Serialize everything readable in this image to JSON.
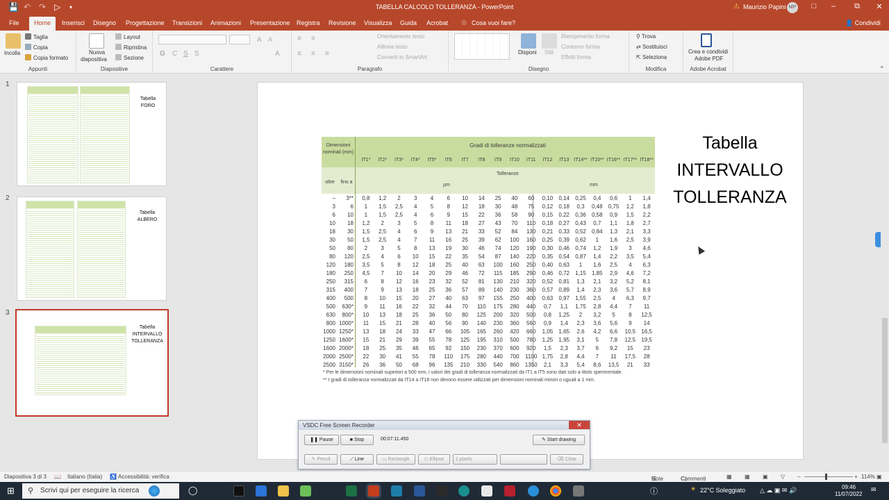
{
  "titlebar": {
    "title": "TABELLA CALCOLO TOLLERANZA - PowerPoint",
    "user": "Maurizio Papini",
    "initials": "MP"
  },
  "tabs": [
    {
      "label": "File"
    },
    {
      "label": "Home"
    },
    {
      "label": "Inserisci"
    },
    {
      "label": "Disegno"
    },
    {
      "label": "Progettazione"
    },
    {
      "label": "Transizioni"
    },
    {
      "label": "Animazioni"
    },
    {
      "label": "Presentazione"
    },
    {
      "label": "Registra"
    },
    {
      "label": "Revisione"
    },
    {
      "label": "Visualizza"
    },
    {
      "label": "Guida"
    },
    {
      "label": "Acrobat"
    },
    {
      "label": "Cosa vuoi fare?"
    }
  ],
  "share_label": "Condividi",
  "ribbon": {
    "appunti": {
      "label": "Appunti",
      "incolla": "Incolla",
      "taglia": "Taglia",
      "copia": "Copia",
      "copia_formato": "Copia formato"
    },
    "diapositive": {
      "label": "Diapositive",
      "nuova": "Nuova",
      "diapositiva": "diapositiva",
      "layout": "Layout",
      "ripristina": "Ripristina",
      "sezione": "Sezione"
    },
    "carattere": {
      "label": "Carattere"
    },
    "paragrafo": {
      "label": "Paragrafo",
      "orientamento": "Orientamento testo",
      "allinea": "Allinea testo",
      "smartart": "Converti in SmartArt"
    },
    "disegno": {
      "label": "Disegno",
      "disponi": "Disponi",
      "stili": "Stili",
      "riempimento": "Riempimento forma",
      "contorno": "Contorno forma",
      "effetti": "Effetti forma"
    },
    "modifica": {
      "label": "Modifica",
      "trova": "Trova",
      "sostituisci": "Sostituisci",
      "seleziona": "Seleziona"
    },
    "acrobat": {
      "label": "Adobe Acrobat",
      "crea": "Crea e condividi",
      "pdf": "Adobe PDF"
    }
  },
  "thumbnails": [
    {
      "num": "1",
      "label1": "Tabella",
      "label2": "FORO",
      "label3": ""
    },
    {
      "num": "2",
      "label1": "Tabella",
      "label2": "ALBERO",
      "label3": ""
    },
    {
      "num": "3",
      "label1": "Tabella",
      "label2": "INTERVALLO",
      "label3": "TOLLERANZA"
    }
  ],
  "slide": {
    "title_line1": "Tabella",
    "title_line2": "INTERVALLO",
    "title_line3": "TOLLERANZA",
    "table": {
      "header_dim": "Dimensioni nominali (mm)",
      "header_grades": "Gradi di tolleranze normalizzati",
      "header_tolleranze": "Tolleranze",
      "header_oltre": "oltre",
      "header_fino": "fino a",
      "unit_um": "µm",
      "unit_mm": "mm",
      "grades": [
        "IT1*",
        "IT2*",
        "IT3*",
        "IT4*",
        "IT5*",
        "IT6",
        "IT7",
        "IT8",
        "IT9",
        "IT10",
        "IT11",
        "IT12",
        "IT13",
        "IT14**",
        "IT15**",
        "IT16**",
        "IT17**",
        "IT18**"
      ],
      "rows": [
        [
          "–",
          "3**",
          "0,8",
          "1,2",
          "2",
          "3",
          "4",
          "6",
          "10",
          "14",
          "25",
          "40",
          "60",
          "0,10",
          "0,14",
          "0,25",
          "0,4",
          "0,6",
          "1",
          "1,4"
        ],
        [
          "3",
          "6",
          "1",
          "1,5",
          "2,5",
          "4",
          "5",
          "8",
          "12",
          "18",
          "30",
          "48",
          "75",
          "0,12",
          "0,18",
          "0,3",
          "0,48",
          "0,75",
          "1,2",
          "1,8"
        ],
        [
          "6",
          "10",
          "1",
          "1,5",
          "2,5",
          "4",
          "6",
          "9",
          "15",
          "22",
          "36",
          "58",
          "90",
          "0,15",
          "0,22",
          "0,36",
          "0,58",
          "0,9",
          "1,5",
          "2,2"
        ],
        [
          "10",
          "18",
          "1,2",
          "2",
          "3",
          "5",
          "8",
          "11",
          "18",
          "27",
          "43",
          "70",
          "110",
          "0,18",
          "0,27",
          "0,43",
          "0,7",
          "1,1",
          "1,8",
          "2,7"
        ],
        [
          "18",
          "30",
          "1,5",
          "2,5",
          "4",
          "6",
          "9",
          "13",
          "21",
          "33",
          "52",
          "84",
          "130",
          "0,21",
          "0,33",
          "0,52",
          "0,84",
          "1,3",
          "2,1",
          "3,3"
        ],
        [
          "30",
          "50",
          "1,5",
          "2,5",
          "4",
          "7",
          "11",
          "16",
          "25",
          "39",
          "62",
          "100",
          "160",
          "0,25",
          "0,39",
          "0,62",
          "1",
          "1,6",
          "2,5",
          "3,9"
        ],
        [
          "50",
          "80",
          "2",
          "3",
          "5",
          "8",
          "13",
          "19",
          "30",
          "46",
          "74",
          "120",
          "190",
          "0,30",
          "0,46",
          "0,74",
          "1,2",
          "1,9",
          "3",
          "4,6"
        ],
        [
          "80",
          "120",
          "2,5",
          "4",
          "6",
          "10",
          "15",
          "22",
          "35",
          "54",
          "87",
          "140",
          "220",
          "0,35",
          "0,54",
          "0,87",
          "1,4",
          "2,2",
          "3,5",
          "5,4"
        ],
        [
          "120",
          "180",
          "3,5",
          "5",
          "8",
          "12",
          "18",
          "25",
          "40",
          "63",
          "100",
          "160",
          "250",
          "0,40",
          "0,63",
          "1",
          "1,6",
          "2,5",
          "4",
          "6,3"
        ],
        [
          "180",
          "250",
          "4,5",
          "7",
          "10",
          "14",
          "20",
          "29",
          "46",
          "72",
          "115",
          "185",
          "290",
          "0,46",
          "0,72",
          "1,15",
          "1,85",
          "2,9",
          "4,6",
          "7,2"
        ],
        [
          "250",
          "315",
          "6",
          "8",
          "12",
          "16",
          "23",
          "32",
          "52",
          "81",
          "130",
          "210",
          "320",
          "0,52",
          "0,81",
          "1,3",
          "2,1",
          "3,2",
          "5,2",
          "8,1"
        ],
        [
          "315",
          "400",
          "7",
          "9",
          "13",
          "18",
          "25",
          "36",
          "57",
          "89",
          "140",
          "230",
          "360",
          "0,57",
          "0,89",
          "1,4",
          "2,3",
          "3,6",
          "5,7",
          "8,9"
        ],
        [
          "400",
          "500",
          "8",
          "10",
          "15",
          "20",
          "27",
          "40",
          "63",
          "97",
          "155",
          "250",
          "400",
          "0,63",
          "0,97",
          "1,55",
          "2,5",
          "4",
          "6,3",
          "9,7"
        ],
        [
          "500",
          "630*",
          "9",
          "11",
          "16",
          "22",
          "32",
          "44",
          "70",
          "110",
          "175",
          "280",
          "440",
          "0,7",
          "1,1",
          "1,75",
          "2,8",
          "4,4",
          "7",
          "11"
        ],
        [
          "630",
          "800*",
          "10",
          "13",
          "18",
          "25",
          "36",
          "50",
          "80",
          "125",
          "200",
          "320",
          "500",
          "0,8",
          "1,25",
          "2",
          "3,2",
          "5",
          "8",
          "12,5"
        ],
        [
          "800",
          "1000*",
          "11",
          "15",
          "21",
          "28",
          "40",
          "56",
          "90",
          "140",
          "230",
          "360",
          "560",
          "0,9",
          "1,4",
          "2,3",
          "3,6",
          "5,6",
          "9",
          "14"
        ],
        [
          "1000",
          "1250*",
          "13",
          "18",
          "24",
          "33",
          "47",
          "66",
          "105",
          "165",
          "260",
          "420",
          "660",
          "1,05",
          "1,65",
          "2,6",
          "4,2",
          "6,6",
          "10,5",
          "16,5"
        ],
        [
          "1250",
          "1600*",
          "15",
          "21",
          "29",
          "39",
          "55",
          "78",
          "125",
          "195",
          "310",
          "500",
          "780",
          "1,25",
          "1,95",
          "3,1",
          "5",
          "7,8",
          "12,5",
          "19,5"
        ],
        [
          "1600",
          "2000*",
          "18",
          "25",
          "35",
          "46",
          "65",
          "92",
          "150",
          "230",
          "370",
          "600",
          "920",
          "1,5",
          "2,3",
          "3,7",
          "6",
          "9,2",
          "15",
          "23"
        ],
        [
          "2000",
          "2500*",
          "22",
          "30",
          "41",
          "55",
          "78",
          "110",
          "175",
          "280",
          "440",
          "700",
          "1100",
          "1,75",
          "2,8",
          "4,4",
          "7",
          "11",
          "17,5",
          "28"
        ],
        [
          "2500",
          "3150*",
          "26",
          "36",
          "50",
          "68",
          "96",
          "135",
          "210",
          "330",
          "540",
          "860",
          "1350",
          "2,1",
          "3,3",
          "5,4",
          "8,6",
          "13,5",
          "21",
          "33"
        ]
      ],
      "footnote1": "* Per le dimensioni nominali superiori a 500 mm, i valori dei gradi di tolleranza normalizzati da IT1 a IT5 sono dati solo a titolo sperimentale.",
      "footnote2": "** I gradi di tolleranza normalizzati da IT14 a IT18 non devono essere utilizzati per dimensioni nominali minori o uguali a 1 mm."
    }
  },
  "recorder": {
    "title": "VSDC Free Screen Recorder",
    "pause": "Pause",
    "stop": "Stop",
    "time": "00:07:11.450",
    "start_drawing": "Start drawing",
    "pencil": "Pencil",
    "line": "Line",
    "rectangle": "Rectangle",
    "ellipse": "Ellipse",
    "pixels": "2 pixels",
    "clear": "Clear"
  },
  "status": {
    "slide": "Diapositiva 3 di 3",
    "language": "Italiano (Italia)",
    "accessibility": "Accessibilità: verifica",
    "note": "Note",
    "comments": "Commenti",
    "zoom": "114%"
  },
  "taskbar": {
    "search": "Scrivi qui per eseguire la ricerca",
    "weather": "22°C Soleggiato",
    "time": "09:46",
    "date": "11/07/2022"
  },
  "colors": {
    "accent": "#b7472a",
    "table_green": "#c9dc9f",
    "selected_border": "#c0392b"
  }
}
